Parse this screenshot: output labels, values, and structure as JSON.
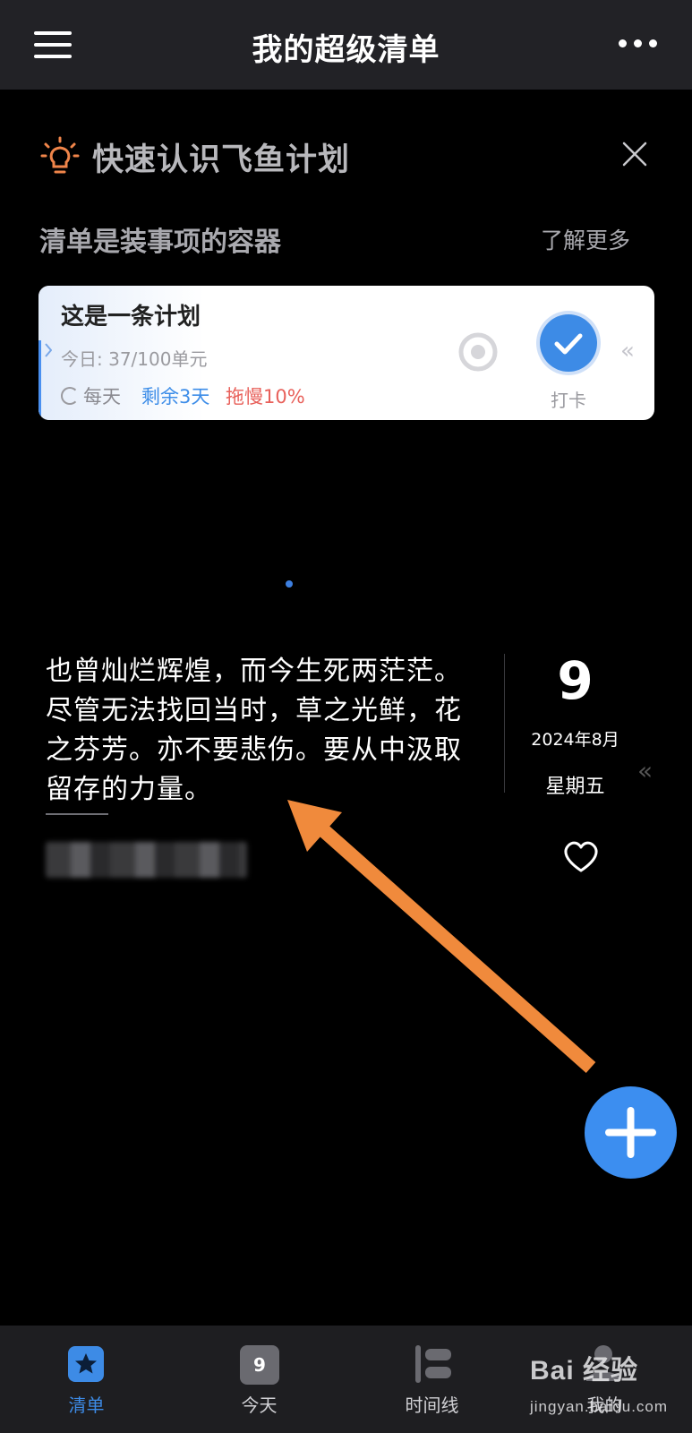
{
  "header": {
    "title": "我的超级清单"
  },
  "intro": {
    "title": "快速认识飞鱼计划",
    "subtitle": "清单是装事项的容器",
    "learn_more": "了解更多"
  },
  "plan_card": {
    "title": "这是一条计划",
    "today_progress": "今日: 37/100单元",
    "repeat": "每天",
    "remaining": "剩余3天",
    "delay": "拖慢10%",
    "checkin_label": "打卡"
  },
  "quote": {
    "text": "也曾灿烂辉煌，而今生死两茫茫。尽管无法找回当时，草之光鲜，花之芬芳。亦不要悲伤。要从中汲取留存的力量。",
    "author": "",
    "day": "9",
    "month": "2024年8月",
    "weekday": "星期五"
  },
  "tabbar": {
    "items": [
      {
        "label": "清单",
        "active": true
      },
      {
        "label": "今天",
        "icon_text": "9"
      },
      {
        "label": "时间线"
      },
      {
        "label": "我的"
      }
    ]
  },
  "watermark": {
    "logo": "Bai 经验",
    "url": "jingyan.baidu.com"
  },
  "colors": {
    "accent": "#3d8be6",
    "topbar": "#222226",
    "background": "#000000",
    "annotation_arrow": "#f08a3c",
    "delay_text": "#e8605a"
  },
  "icons": [
    "menu-icon",
    "more-icon",
    "bulb-icon",
    "close-icon",
    "target-icon",
    "check-icon",
    "heart-icon",
    "plus-icon",
    "star-list-icon",
    "calendar-icon",
    "timeline-icon",
    "profile-icon"
  ]
}
